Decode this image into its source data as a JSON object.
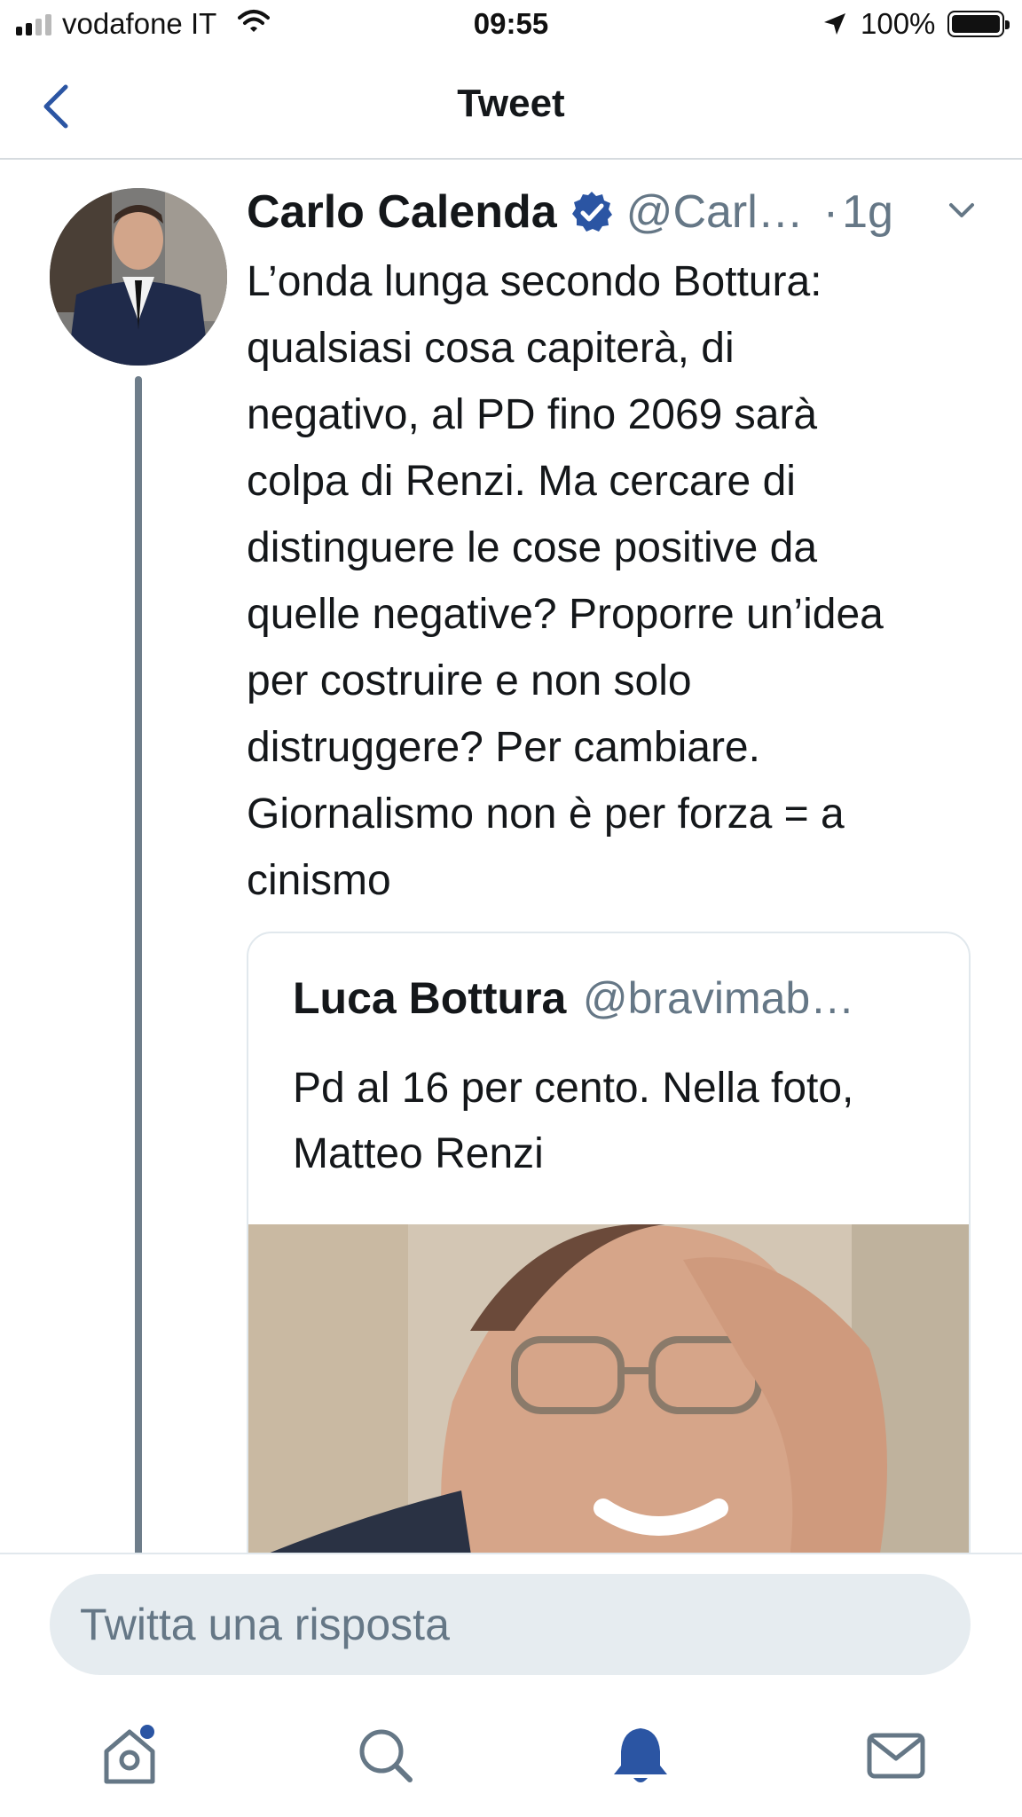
{
  "status_bar": {
    "carrier": "vodafone IT",
    "time": "09:55",
    "battery_percent": "100%",
    "signal_bars_filled": 2,
    "signal_bars_total": 4,
    "battery_level": 1.0
  },
  "nav": {
    "title": "Tweet",
    "back_icon": "chevron-left-icon"
  },
  "tweet": {
    "author_name": "Carlo Calenda",
    "handle": "@Carl…",
    "separator": "·",
    "time_ago": "1g",
    "verified_icon": "verified-badge-icon",
    "menu_icon": "chevron-down-icon",
    "text": "L’onda lunga secondo Bottura:\nqualsiasi cosa capiterà, di\nnegativo, al PD fino 2069 sarà\ncolpa di Renzi. Ma cercare di\ndistinguere le cose positive da\nquelle negative? Proporre un’idea\nper costruire e non solo\ndistruggere? Per cambiare.\nGiornalismo non è per forza = a\ncinismo"
  },
  "quoted_tweet": {
    "author_name": "Luca Bottura",
    "handle": "@bravimab…",
    "text": "Pd al 16 per cento. Nella foto, Matteo Renzi"
  },
  "composer": {
    "placeholder": "Twitta una risposta"
  },
  "tabbar": {
    "items": [
      {
        "icon": "home-icon",
        "has_dot": true
      },
      {
        "icon": "search-icon"
      },
      {
        "icon": "notifications-bell-icon",
        "active": true
      },
      {
        "icon": "messages-envelope-icon"
      }
    ]
  },
  "colors": {
    "accent": "#1da1f2",
    "active_tab": "#2b55a3",
    "text": "#14171a",
    "secondary_text": "#657786",
    "verified": "#2b55a3"
  }
}
